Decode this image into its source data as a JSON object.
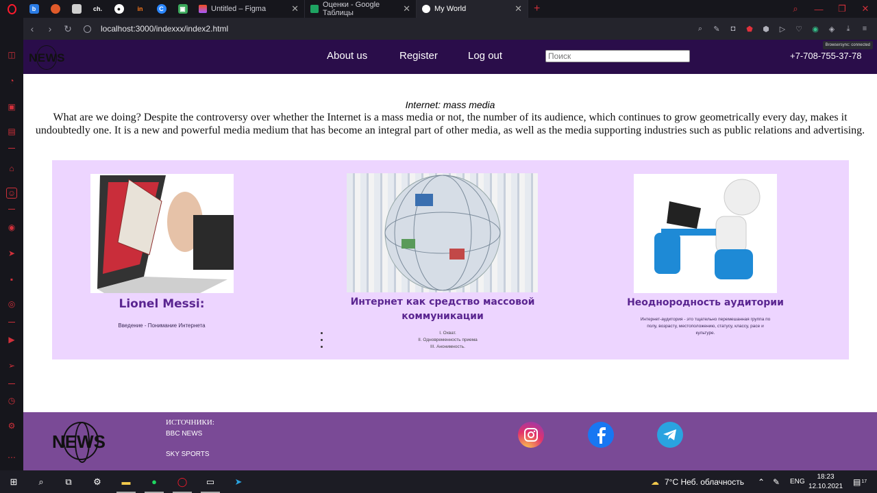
{
  "browser": {
    "tabs": [
      {
        "label": "Untitled – Figma",
        "icon": "figma-icon"
      },
      {
        "label": "Оценки - Google Таблицы",
        "icon": "sheets-icon"
      },
      {
        "label": "My World",
        "icon": "globe-icon",
        "active": true
      }
    ],
    "pinned_tabs": [
      {
        "icon": "bing-icon",
        "glyph": "b",
        "color": "#2a7be4"
      },
      {
        "icon": "circle-app-icon",
        "glyph": "•",
        "color": "#e05a2a"
      },
      {
        "icon": "doc-icon",
        "glyph": "",
        "color": "#cfcfcf"
      },
      {
        "icon": "ch-icon",
        "glyph": "ch.",
        "color": "#16161c"
      },
      {
        "icon": "github-icon",
        "glyph": "●",
        "color": "#ffffff"
      },
      {
        "icon": "in-icon",
        "glyph": "in",
        "color": "#ff7a1a"
      },
      {
        "icon": "c-icon",
        "glyph": "C",
        "color": "#2a86ff"
      },
      {
        "icon": "image-icon",
        "glyph": "▣",
        "color": "#3aa85a"
      }
    ],
    "new_tab_label": "+",
    "url": "localhost:3000/indexxx/index2.html",
    "sync_tooltip": "Browsersync: connected"
  },
  "site": {
    "logo_text": "NEWS",
    "nav": [
      {
        "label": "About us"
      },
      {
        "label": "Register"
      },
      {
        "label": "Log out"
      }
    ],
    "search_placeholder": "Поиск",
    "phone": "+7-708-755-37-78",
    "intro_title": "Internet: mass media",
    "intro_text": "What are we doing? Despite the controversy over whether the Internet is a mass media or not, the number of its audience, which continues to grow geometrically every day, makes it undoubtedly one. It is a new and powerful media medium that has become an integral part of other media, as well as the media supporting industries such as public relations and advertising.",
    "cards": [
      {
        "title": "Lionel Messi:",
        "subtitle": "Введение - Понимание Интернета"
      },
      {
        "title": "Интернет как средство массовой коммуникации",
        "list": [
          "I. Охват.",
          "II. Одновременность приема",
          "III. Анонимность."
        ]
      },
      {
        "title": "Неоднородность аудитории",
        "subtitle": "Интернет-аудитория - это тщательно перемешанная группа по полу, возрасту, местоположению, статусу, классу, расе и культуре."
      }
    ],
    "footer": {
      "sources_heading": "ИСТОЧНИКИ:",
      "sources": [
        "BBC NEWS",
        "SKY SPORTS"
      ],
      "social": [
        "instagram-icon",
        "facebook-icon",
        "telegram-icon"
      ]
    }
  },
  "taskbar": {
    "weather": "7°C  Неб. облачность",
    "lang": "ENG",
    "time": "18:23",
    "date": "12.10.2021",
    "notifications": "17"
  }
}
